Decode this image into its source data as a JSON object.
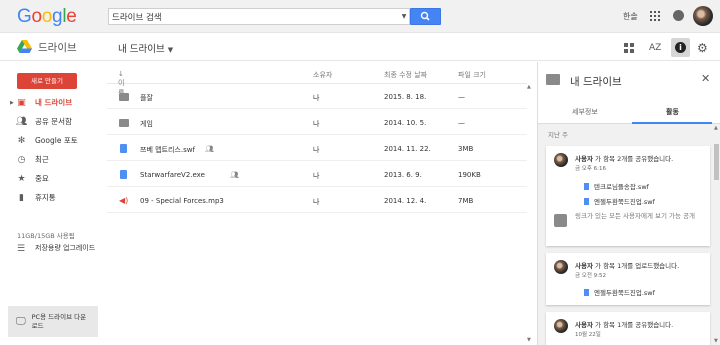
{
  "header": {
    "logo_text": "Google",
    "search": {
      "value": "드라이브 검색"
    },
    "user_name": "한솔",
    "icons": [
      "apps-grid-icon",
      "notifications-icon",
      "search-icon"
    ]
  },
  "subbar": {
    "product_name": "드라이브",
    "breadcrumb": "내 드라이브",
    "sort_label": "AZ",
    "info_label": "i"
  },
  "sidebar": {
    "new_button": "새로 만들기",
    "items": [
      {
        "label": "내 드라이브",
        "icon": "drive-folder-icon",
        "active": true
      },
      {
        "label": "공유 문서함",
        "icon": "people-icon",
        "active": false
      },
      {
        "label": "Google 포토",
        "icon": "photos-icon",
        "active": false
      },
      {
        "label": "최근",
        "icon": "clock-icon",
        "active": false
      },
      {
        "label": "중요",
        "icon": "star-icon",
        "active": false
      },
      {
        "label": "휴지통",
        "icon": "trash-icon",
        "active": false
      }
    ],
    "storage": "11GB/15GB 사용됨",
    "upgrade": "저장용량 업그레이드",
    "pc_drive": "PC용 드라이브 다운로드"
  },
  "files": {
    "columns": {
      "name": "이름",
      "owner": "소유자",
      "modified": "최종 수정 날짜",
      "size": "파일 크기"
    },
    "rows": [
      {
        "name": "플잘",
        "type": "folder",
        "shared": false,
        "owner": "나",
        "modified": "2015. 8. 18.",
        "size": "—"
      },
      {
        "name": "게임",
        "type": "folder",
        "shared": false,
        "owner": "나",
        "modified": "2014. 10. 5.",
        "size": "—"
      },
      {
        "name": "쯔베 맵트리스.swf",
        "type": "doc",
        "shared": true,
        "owner": "나",
        "modified": "2014. 11. 22.",
        "size": "3MB"
      },
      {
        "name": "StarwarfareV2.exe",
        "type": "doc",
        "shared": true,
        "owner": "나",
        "modified": "2013. 6. 9.",
        "size": "190KB"
      },
      {
        "name": "09 - Special Forces.mp3",
        "type": "audio",
        "shared": false,
        "owner": "나",
        "modified": "2014. 12. 4.",
        "size": "7MB"
      }
    ]
  },
  "panel": {
    "title": "내 드라이브",
    "tabs": [
      "세부정보",
      "활동"
    ],
    "active_tab": "활동",
    "period": "지난 주",
    "activities": [
      {
        "user": "사용자",
        "action": "가 항목 2개를 공유했습니다.",
        "when": "금 오후 6:16",
        "files": [
          "텐크로님플송잡.swf",
          "엔젤두환쭉드진업.swf"
        ],
        "note": "링크가 있는 모든 사용자에게  보기 가능 공개"
      },
      {
        "user": "사용자",
        "action": "가 항목 1개를 업로드했습니다.",
        "when": "금 오전 9:52",
        "files": [
          "엔젤두환쭉드진업.swf"
        ]
      },
      {
        "user": "사용자",
        "action": "가 항목 1개를 공유했습니다.",
        "when": "10월 22일",
        "files": []
      }
    ]
  }
}
